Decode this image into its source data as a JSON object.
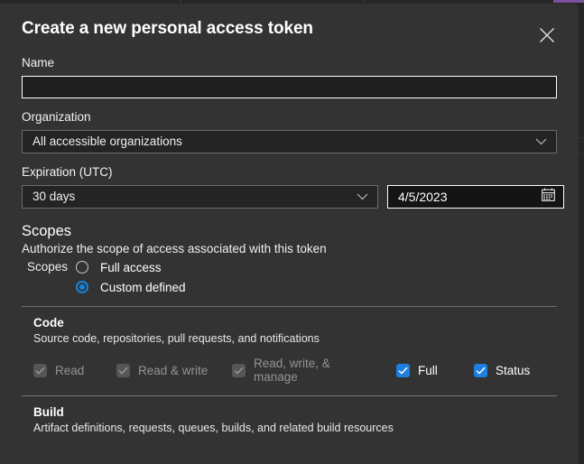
{
  "dialog": {
    "title": "Create a new personal access token",
    "close_icon": "close-icon"
  },
  "form": {
    "name": {
      "label": "Name",
      "value": "",
      "placeholder": ""
    },
    "organization": {
      "label": "Organization",
      "selected": "All accessible organizations",
      "chevron_icon": "chevron-down-icon"
    },
    "expiration": {
      "label": "Expiration (UTC)",
      "duration_selected": "30 days",
      "date_value": "4/5/2023",
      "calendar_icon": "calendar-icon",
      "chevron_icon": "chevron-down-icon"
    }
  },
  "scopes": {
    "heading": "Scopes",
    "description": "Authorize the scope of access associated with this token",
    "legend": "Scopes",
    "options": [
      {
        "label": "Full access",
        "checked": false
      },
      {
        "label": "Custom defined",
        "checked": true
      }
    ]
  },
  "groups": [
    {
      "title": "Code",
      "description": "Source code, repositories, pull requests, and notifications",
      "checkboxes": [
        {
          "label": "Read",
          "checked": true,
          "disabled": true
        },
        {
          "label": "Read & write",
          "checked": true,
          "disabled": true
        },
        {
          "label": "Read, write, & manage",
          "checked": true,
          "disabled": true
        },
        {
          "label": "Full",
          "checked": true,
          "disabled": false
        },
        {
          "label": "Status",
          "checked": true,
          "disabled": false
        }
      ]
    },
    {
      "title": "Build",
      "description": "Artifact definitions, requests, queues, builds, and related build resources"
    }
  ],
  "colors": {
    "accent_blue": "#1d7fe0",
    "radio_blue": "#1385e0",
    "dialog_bg": "#333333",
    "page_bg": "#262626",
    "input_bg": "#1f1f1f",
    "purple_accent": "#7a4f9e"
  }
}
